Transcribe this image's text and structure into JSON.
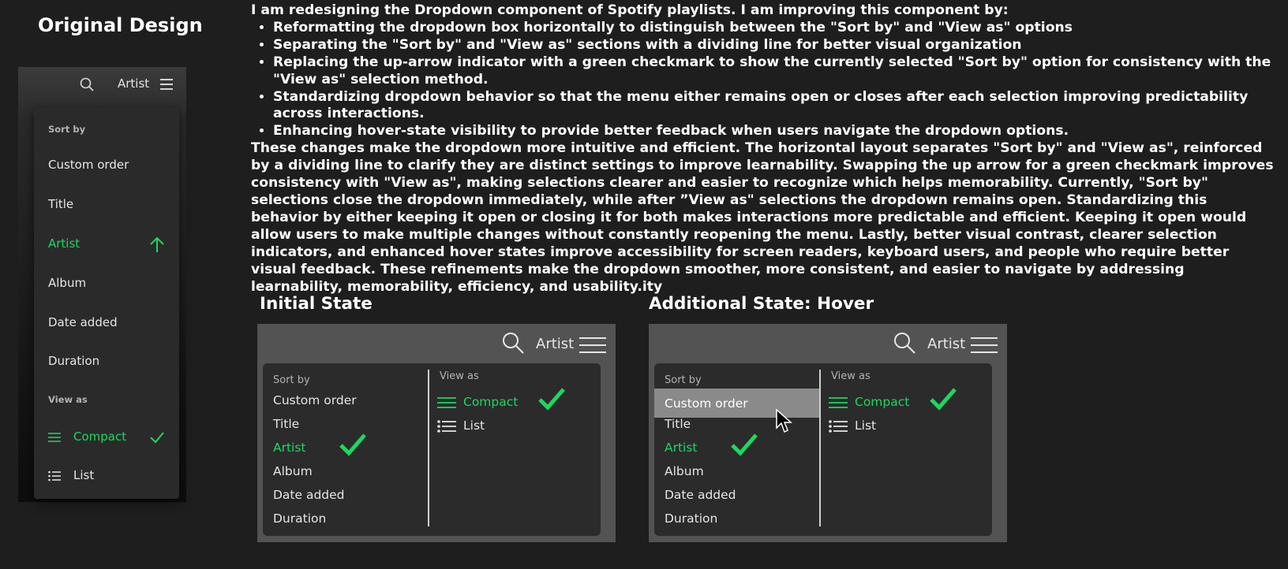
{
  "original": {
    "title": "Original Design",
    "header_label": "Artist",
    "sort_heading": "Sort by",
    "sort_items": [
      "Custom order",
      "Title",
      "Artist",
      "Album",
      "Date added",
      "Duration"
    ],
    "view_heading": "View as",
    "view_items": [
      "Compact",
      "List"
    ],
    "selected_sort": "Artist",
    "selected_view": "Compact"
  },
  "description": {
    "intro": "I am redesigning the Dropdown component of Spotify playlists. I am improving this component by:",
    "bullets": [
      "Reformatting the dropdown box horizontally to distinguish between the \"Sort by\" and \"View as\" options",
      "Separating the \"Sort by\" and \"View as\" sections with a dividing line for better visual organization",
      "Replacing the up-arrow indicator with a green checkmark to show the currently selected \"Sort by\" option for consistency with the \"View as\" selection method.",
      "Standardizing dropdown behavior so that the menu either remains open or closes after each selection improving predictability across interactions.",
      "Enhancing hover-state visibility to provide better feedback when users navigate the dropdown options."
    ],
    "body": "These changes make the dropdown more intuitive and efficient. The horizontal layout separates \"Sort by\" and \"View as\", reinforced by a dividing line to clarify they are distinct settings to improve learnability. Swapping the up arrow for a green checkmark improves consistency with \"View as\", making selections clearer and easier to recognize which helps memorability. Currently, \"Sort by\" selections close the dropdown immediately, while after ”View as\" selections the dropdown remains open. Standardizing this behavior by either keeping it open or closing it for both makes interactions more predictable and efficient. Keeping it open would allow users to make multiple changes without constantly reopening the menu. Lastly, better visual contrast, clearer selection indicators, and enhanced hover states improve accessibility for screen readers, keyboard users, and people who require better visual feedback. These refinements make the dropdown smoother, more consistent, and easier to navigate by addressing learnability, memorability, efficiency, and usability.ity"
  },
  "initial_state": {
    "title": "Initial State",
    "header_label": "Artist",
    "sort_heading": "Sort by",
    "sort_items": [
      "Custom order",
      "Title",
      "Artist",
      "Album",
      "Date added",
      "Duration"
    ],
    "view_heading": "View as",
    "view_items": [
      "Compact",
      "List"
    ]
  },
  "hover_state": {
    "title": "Additional State: Hover",
    "header_label": "Artist",
    "sort_heading": "Sort by",
    "sort_items": [
      "Custom order",
      "Title",
      "Artist",
      "Album",
      "Date added",
      "Duration"
    ],
    "view_heading": "View as",
    "view_items": [
      "Compact",
      "List"
    ],
    "hovered_item": "Custom order"
  },
  "colors": {
    "accent": "#1ed760",
    "background": "#1e1e1e",
    "panel": "#2b2b2b",
    "hover": "#8a8a8a"
  },
  "icons": [
    "search-icon",
    "hamburger-menu-icon",
    "arrow-up-icon",
    "checkmark-icon",
    "compact-view-icon",
    "list-view-icon",
    "mouse-cursor-icon"
  ]
}
